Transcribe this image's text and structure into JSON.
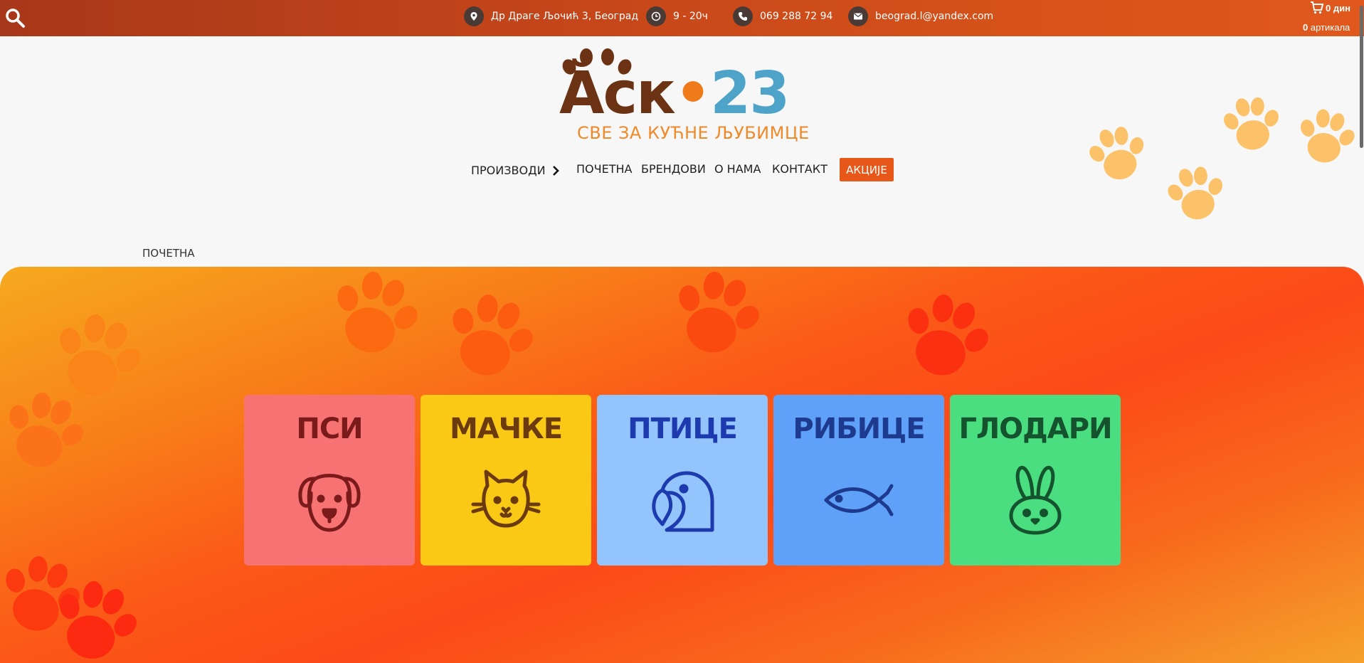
{
  "topbar": {
    "address": "Др Драге Љочић 3, Београд",
    "hours": "9 - 20ч",
    "phone": "069 288 72 94",
    "email": "beograd.l@yandex.com",
    "cart_total": "0 дин",
    "cart_count": "0",
    "cart_count_label": "артикала"
  },
  "logo": {
    "part1": "Ăск",
    "dot": "•",
    "part2": "23",
    "subtitle": "СВЕ ЗА КУЋНЕ ЉУБИМЦЕ"
  },
  "nav": {
    "products": "ПРОИЗВОДИ",
    "home": "ПОЧЕТНА",
    "brands": "БРЕНДОВИ",
    "about": "О НАМА",
    "contact": "КОНТАКТ",
    "sale": "АКЦИЈЕ"
  },
  "breadcrumb": "ПОЧЕТНА",
  "categories": [
    {
      "label": "ПСИ",
      "icon": "dog-icon",
      "bg": "#f77272",
      "fg": "#7a1a1a"
    },
    {
      "label": "МАЧКЕ",
      "icon": "cat-icon",
      "bg": "#f9c916",
      "fg": "#6b3a0e"
    },
    {
      "label": "ПТИЦЕ",
      "icon": "bird-icon",
      "bg": "#93c5fc",
      "fg": "#1e3aaf"
    },
    {
      "label": "РИБИЦЕ",
      "icon": "fish-icon",
      "bg": "#5fa1f8",
      "fg": "#1e3a8f"
    },
    {
      "label": "ГЛОДАРИ",
      "icon": "rabbit-icon",
      "bg": "#4ade80",
      "fg": "#14532d"
    }
  ],
  "colors": {
    "accent": "#e8571a",
    "paw_light": "#fcc26a",
    "logo_brown": "#6b3213",
    "logo_blue": "#4ea3c9"
  }
}
